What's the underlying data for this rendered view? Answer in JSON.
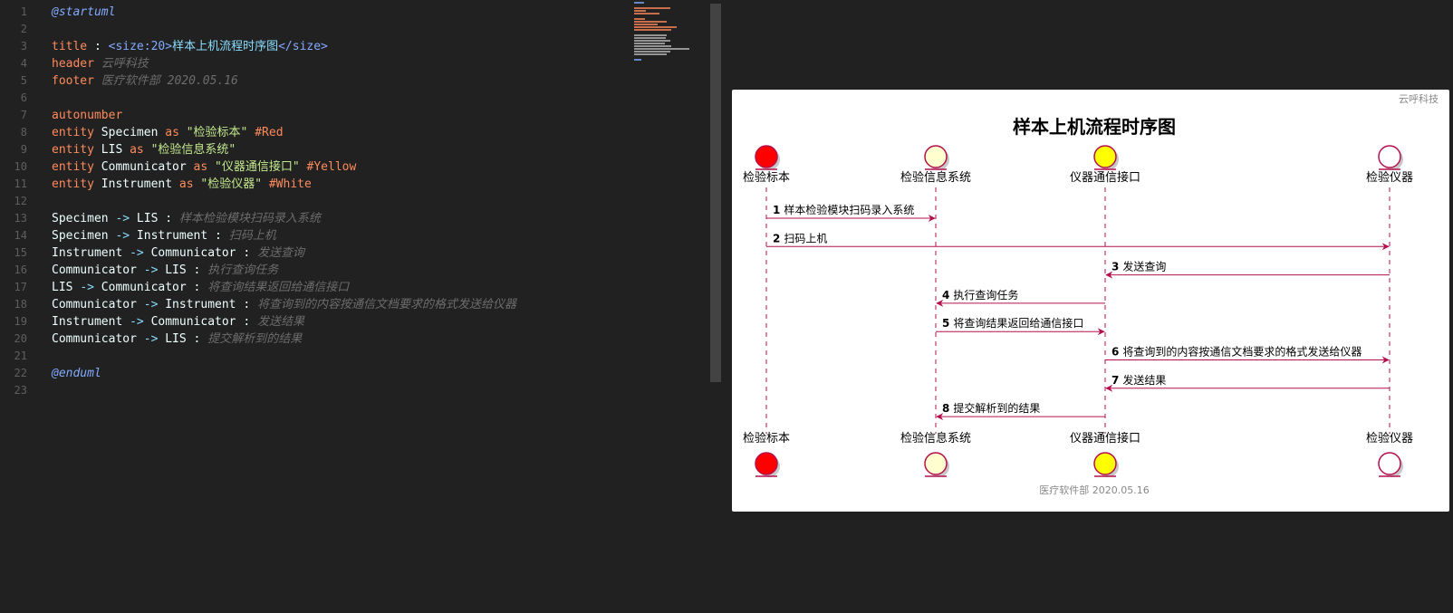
{
  "editor": {
    "lines": [
      {
        "n": "1",
        "tokens": [
          {
            "c": "t-dir",
            "t": "@startuml"
          }
        ]
      },
      {
        "n": "2",
        "tokens": []
      },
      {
        "n": "3",
        "tokens": [
          {
            "c": "t-kw",
            "t": "title"
          },
          {
            "c": "t-id",
            "t": " : "
          },
          {
            "c": "t-tagn",
            "t": "<size:20>"
          },
          {
            "c": "t-tag",
            "t": "样本上机流程时序图"
          },
          {
            "c": "t-tagn",
            "t": "</size>"
          }
        ]
      },
      {
        "n": "4",
        "tokens": [
          {
            "c": "t-kw",
            "t": "header"
          },
          {
            "c": "t-com",
            "t": " 云呼科技"
          }
        ]
      },
      {
        "n": "5",
        "tokens": [
          {
            "c": "t-kw",
            "t": "footer"
          },
          {
            "c": "t-com",
            "t": " 医疗软件部 2020.05.16"
          }
        ]
      },
      {
        "n": "6",
        "tokens": []
      },
      {
        "n": "7",
        "tokens": [
          {
            "c": "t-kw",
            "t": "autonumber"
          }
        ]
      },
      {
        "n": "8",
        "tokens": [
          {
            "c": "t-kw",
            "t": "entity"
          },
          {
            "c": "t-id",
            "t": " Specimen "
          },
          {
            "c": "t-kw",
            "t": "as"
          },
          {
            "c": "t-str",
            "t": " \"检验标本\" "
          },
          {
            "c": "t-col",
            "t": "#Red"
          }
        ]
      },
      {
        "n": "9",
        "tokens": [
          {
            "c": "t-kw",
            "t": "entity"
          },
          {
            "c": "t-id",
            "t": " LIS "
          },
          {
            "c": "t-kw",
            "t": "as"
          },
          {
            "c": "t-str",
            "t": " \"检验信息系统\""
          }
        ]
      },
      {
        "n": "10",
        "tokens": [
          {
            "c": "t-kw",
            "t": "entity"
          },
          {
            "c": "t-id",
            "t": " Communicator "
          },
          {
            "c": "t-kw",
            "t": "as"
          },
          {
            "c": "t-str",
            "t": " \"仪器通信接口\" "
          },
          {
            "c": "t-col",
            "t": "#Yellow"
          }
        ]
      },
      {
        "n": "11",
        "tokens": [
          {
            "c": "t-kw",
            "t": "entity"
          },
          {
            "c": "t-id",
            "t": " Instrument "
          },
          {
            "c": "t-kw",
            "t": "as"
          },
          {
            "c": "t-str",
            "t": " \"检验仪器\" "
          },
          {
            "c": "t-col",
            "t": "#White"
          }
        ]
      },
      {
        "n": "12",
        "tokens": []
      },
      {
        "n": "13",
        "tokens": [
          {
            "c": "t-id",
            "t": "Specimen "
          },
          {
            "c": "t-arr",
            "t": "->"
          },
          {
            "c": "t-id",
            "t": " LIS : "
          },
          {
            "c": "t-com",
            "t": "样本检验模块扫码录入系统"
          }
        ]
      },
      {
        "n": "14",
        "tokens": [
          {
            "c": "t-id",
            "t": "Specimen "
          },
          {
            "c": "t-arr",
            "t": "->"
          },
          {
            "c": "t-id",
            "t": " Instrument : "
          },
          {
            "c": "t-com",
            "t": "扫码上机"
          }
        ]
      },
      {
        "n": "15",
        "tokens": [
          {
            "c": "t-id",
            "t": "Instrument "
          },
          {
            "c": "t-arr",
            "t": "->"
          },
          {
            "c": "t-id",
            "t": " Communicator : "
          },
          {
            "c": "t-com",
            "t": "发送查询"
          }
        ]
      },
      {
        "n": "16",
        "tokens": [
          {
            "c": "t-id",
            "t": "Communicator "
          },
          {
            "c": "t-arr",
            "t": "->"
          },
          {
            "c": "t-id",
            "t": " LIS : "
          },
          {
            "c": "t-com",
            "t": "执行查询任务"
          }
        ]
      },
      {
        "n": "17",
        "tokens": [
          {
            "c": "t-id",
            "t": "LIS "
          },
          {
            "c": "t-arr",
            "t": "->"
          },
          {
            "c": "t-id",
            "t": " Communicator : "
          },
          {
            "c": "t-com",
            "t": "将查询结果返回给通信接口"
          }
        ]
      },
      {
        "n": "18",
        "tokens": [
          {
            "c": "t-id",
            "t": "Communicator "
          },
          {
            "c": "t-arr",
            "t": "->"
          },
          {
            "c": "t-id",
            "t": " Instrument : "
          },
          {
            "c": "t-com",
            "t": "将查询到的内容按通信文档要求的格式发送给仪器"
          }
        ]
      },
      {
        "n": "19",
        "tokens": [
          {
            "c": "t-id",
            "t": "Instrument "
          },
          {
            "c": "t-arr",
            "t": "->"
          },
          {
            "c": "t-id",
            "t": " Communicator : "
          },
          {
            "c": "t-com",
            "t": "发送结果"
          }
        ]
      },
      {
        "n": "20",
        "tokens": [
          {
            "c": "t-id",
            "t": "Communicator "
          },
          {
            "c": "t-arr",
            "t": "->"
          },
          {
            "c": "t-id",
            "t": " LIS : "
          },
          {
            "c": "t-com",
            "t": "提交解析到的结果"
          }
        ]
      },
      {
        "n": "21",
        "tokens": []
      },
      {
        "n": "22",
        "tokens": [
          {
            "c": "t-dir",
            "t": "@enduml"
          }
        ]
      },
      {
        "n": "23",
        "tokens": []
      }
    ]
  },
  "diagram": {
    "header": "云呼科技",
    "title": "样本上机流程时序图",
    "footer": "医疗软件部 2020.05.16",
    "line_color": "#b5104d",
    "participants": [
      {
        "id": "Specimen",
        "label": "检验标本",
        "fill": "#ff0000"
      },
      {
        "id": "LIS",
        "label": "检验信息系统",
        "fill": "#fefece"
      },
      {
        "id": "Communicator",
        "label": "仪器通信接口",
        "fill": "#ffff00"
      },
      {
        "id": "Instrument",
        "label": "检验仪器",
        "fill": "#ffffff"
      }
    ],
    "messages": [
      {
        "num": "1",
        "from": "Specimen",
        "to": "LIS",
        "text": "样本检验模块扫码录入系统"
      },
      {
        "num": "2",
        "from": "Specimen",
        "to": "Instrument",
        "text": "扫码上机"
      },
      {
        "num": "3",
        "from": "Instrument",
        "to": "Communicator",
        "text": "发送查询"
      },
      {
        "num": "4",
        "from": "Communicator",
        "to": "LIS",
        "text": "执行查询任务"
      },
      {
        "num": "5",
        "from": "LIS",
        "to": "Communicator",
        "text": "将查询结果返回给通信接口"
      },
      {
        "num": "6",
        "from": "Communicator",
        "to": "Instrument",
        "text": "将查询到的内容按通信文档要求的格式发送给仪器"
      },
      {
        "num": "7",
        "from": "Instrument",
        "to": "Communicator",
        "text": "发送结果"
      },
      {
        "num": "8",
        "from": "Communicator",
        "to": "LIS",
        "text": "提交解析到的结果"
      }
    ]
  }
}
